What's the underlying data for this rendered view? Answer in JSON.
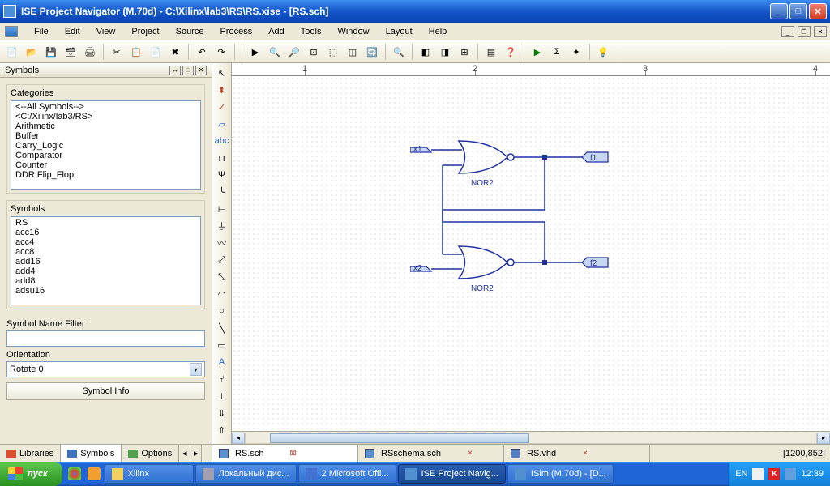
{
  "window": {
    "title": "ISE Project Navigator (M.70d) - C:\\Xilinx\\lab3\\RS\\RS.xise - [RS.sch]"
  },
  "menu": {
    "items": [
      "File",
      "Edit",
      "View",
      "Project",
      "Source",
      "Process",
      "Add",
      "Tools",
      "Window",
      "Layout",
      "Help"
    ]
  },
  "sidebar": {
    "title": "Symbols",
    "categories_label": "Categories",
    "categories": [
      "<--All Symbols-->",
      "<C:/Xilinx/lab3/RS>",
      "Arithmetic",
      "Buffer",
      "Carry_Logic",
      "Comparator",
      "Counter",
      "DDR Flip_Flop"
    ],
    "symbols_label": "Symbols",
    "symbols_list": [
      "RS",
      "acc16",
      "acc4",
      "acc8",
      "add16",
      "add4",
      "add8",
      "adsu16"
    ],
    "filter_label": "Symbol Name Filter",
    "filter_value": "",
    "orientation_label": "Orientation",
    "orientation_value": "Rotate 0",
    "info_btn": "Symbol Info",
    "tabs": {
      "libraries": "Libraries",
      "symbols": "Symbols",
      "options": "Options"
    }
  },
  "schematic": {
    "gates": [
      {
        "label": "NOR2",
        "inputs": [
          "x1"
        ],
        "output": "f1"
      },
      {
        "label": "NOR2",
        "inputs": [
          "x2"
        ],
        "output": "f2"
      }
    ]
  },
  "doc_tabs": {
    "items": [
      {
        "label": "RS.sch",
        "active": true
      },
      {
        "label": "RSschema.sch",
        "active": false
      },
      {
        "label": "RS.vhd",
        "active": false
      }
    ]
  },
  "status": {
    "coords": "[1200,852]"
  },
  "taskbar": {
    "start": "пуск",
    "items": [
      {
        "label": "Xilinx"
      },
      {
        "label": "Локальный дис..."
      },
      {
        "label": "2 Microsoft Offi..."
      },
      {
        "label": "ISE Project Navig..."
      },
      {
        "label": "ISim (M.70d) - [D..."
      }
    ],
    "tray": {
      "lang": "EN",
      "time": "12:39"
    }
  },
  "ruler": {
    "marks": [
      "1",
      "2",
      "3",
      "4"
    ]
  }
}
